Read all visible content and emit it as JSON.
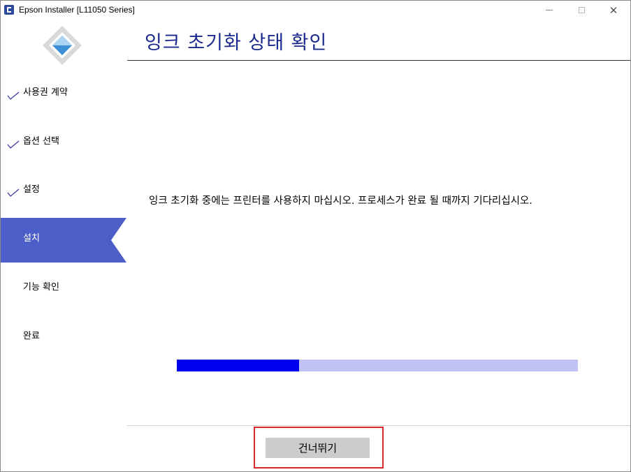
{
  "window": {
    "title": "Epson Installer [L11050 Series]",
    "controls": {
      "minimize": "minimize-icon",
      "maximize": "maximize-icon",
      "close": "close-icon",
      "close_glyph": "✕"
    }
  },
  "sidebar": {
    "logo": "epson-installer-logo",
    "items": [
      {
        "label": "사용권 계약",
        "state": "completed"
      },
      {
        "label": "옵션 선택",
        "state": "completed"
      },
      {
        "label": "설정",
        "state": "completed"
      },
      {
        "label": "설치",
        "state": "active"
      },
      {
        "label": "기능 확인",
        "state": "pending"
      },
      {
        "label": "완료",
        "state": "pending"
      }
    ]
  },
  "main": {
    "title": "잉크 초기화 상태 확인",
    "message": "잉크 초기화 중에는 프린터를 사용하지 마십시오. 프로세스가 완료 될 때까지 기다리십시오.",
    "progress": {
      "fraction": 0.305
    }
  },
  "footer": {
    "skip_label": "건너뛰기"
  },
  "colors": {
    "accent": "#4c5fc8",
    "title": "#1b2a8c",
    "progress_fill": "#0000f0",
    "progress_track": "#c0c2f6",
    "highlight": "#d42a2a"
  }
}
